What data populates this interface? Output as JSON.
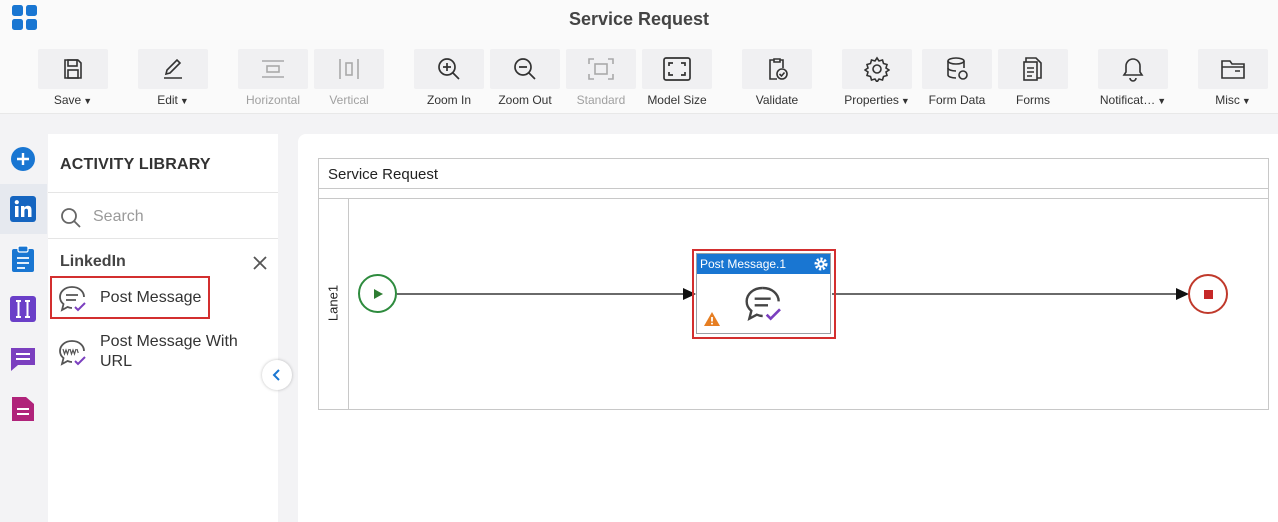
{
  "header": {
    "title": "Service Request"
  },
  "toolbar": {
    "save": "Save",
    "edit": "Edit",
    "horizontal": "Horizontal",
    "vertical": "Vertical",
    "zoom_in": "Zoom In",
    "zoom_out": "Zoom Out",
    "standard": "Standard",
    "model_size": "Model Size",
    "validate": "Validate",
    "properties": "Properties",
    "form_data": "Form Data",
    "forms": "Forms",
    "notifications": "Notificat…",
    "misc": "Misc"
  },
  "library": {
    "title": "ACTIVITY LIBRARY",
    "search_placeholder": "Search",
    "category": "LinkedIn",
    "items": [
      {
        "label": "Post Message"
      },
      {
        "label": "Post Message With URL"
      }
    ]
  },
  "canvas": {
    "pool_title": "Service Request",
    "lane_label": "Lane1",
    "task_label": "Post Message.1"
  },
  "colors": {
    "accent": "#1976d2",
    "highlight": "#d32f2f",
    "start": "#2e8b3e",
    "end": "#c62828",
    "warning": "#e67e22"
  }
}
